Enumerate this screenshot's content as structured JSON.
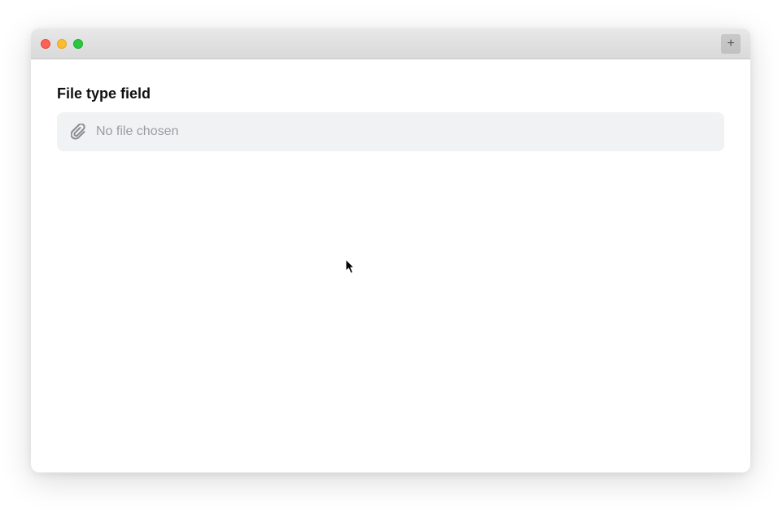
{
  "heading": "File type field",
  "fileField": {
    "placeholder": "No file chosen",
    "iconName": "paperclip-icon"
  },
  "titlebar": {
    "plusIcon": "+"
  }
}
